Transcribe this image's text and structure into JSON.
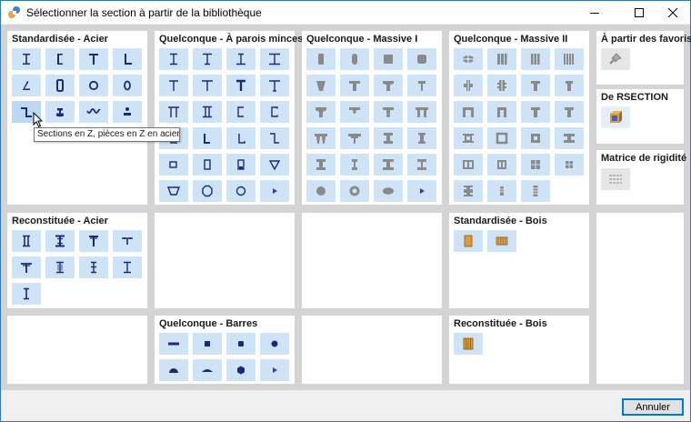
{
  "window": {
    "title": "Sélectionner la section à partir de la bibliothèque",
    "minimize_glyph": "—",
    "maximize_glyph": "☐",
    "close_glyph": "✕"
  },
  "colors": {
    "tile_bg": "#cfe3f7",
    "icon_navy": "#1b2a78",
    "icon_gray": "#8a8a8a",
    "wood_orange": "#e29a36",
    "panel_bg": "#ffffff",
    "gap_bg": "#d4d4d4"
  },
  "panels": {
    "std_acier": {
      "title": "Standardisée - Acier",
      "icons": [
        "i-section-icon",
        "channel-section-icon",
        "t-section-icon",
        "angle-section-icon",
        "unequal-angle-icon",
        "rectangular-hollow-icon",
        "circular-hollow-icon",
        "rounded-hollow-icon",
        "z-section-icon",
        "rail-section-icon",
        "corrugated-sheet-icon",
        "bulb-flat-icon"
      ]
    },
    "parois_minces": {
      "title": "Quelconque - À parois minces",
      "icons": [
        "thin-i-icon",
        "thin-i-unequal-icon",
        "thin-i-tapered-icon",
        "thin-i-wide-icon",
        "thin-t-icon",
        "thin-t-wide-icon",
        "thin-t-flanged-icon",
        "thin-t-heavy-icon",
        "thin-pi-icon",
        "thin-double-i-icon",
        "thin-channel-icon",
        "thin-channel-lipped-icon",
        "thin-angle-icon",
        "thin-angle-wide-icon",
        "thin-angle-lipped-icon",
        "thin-z-icon",
        "thin-box-icon",
        "thin-rect-icon",
        "thin-rect-closed-icon",
        "thin-triangle-icon",
        "thin-trapezoid-icon",
        "thin-octagon-icon",
        "thin-circle-icon",
        "more-arrow-icon"
      ]
    },
    "massive_1": {
      "title": "Quelconque - Massive I",
      "icons": [
        "solid-rect-icon",
        "solid-rounded-rect-icon",
        "solid-square-icon",
        "solid-rounded-square-icon",
        "solid-trapezoid-icon",
        "solid-t-icon",
        "solid-t-tapered-icon",
        "solid-t-narrow-icon",
        "solid-inverted-t-icon",
        "solid-tee-beam-icon",
        "solid-t-bulb-icon",
        "solid-double-t-icon",
        "solid-pi-icon",
        "solid-double-pi-icon",
        "solid-i-icon",
        "solid-i-heavy-icon",
        "solid-i-tapered-icon",
        "solid-i-narrow-icon",
        "solid-i-wide-icon",
        "solid-i-flanged-icon",
        "solid-circle-icon",
        "solid-ring-icon",
        "solid-ellipse-icon",
        "more-arrow-icon"
      ]
    },
    "massive_2": {
      "title": "Quelconque - Massive II",
      "icons": [
        "solid-double-ellipse-icon",
        "solid-triple-rect-icon",
        "solid-quad-rect-icon",
        "solid-multi-rect-icon",
        "solid-cross-icon",
        "solid-double-cross-icon",
        "solid-t-stem-icon",
        "solid-t-stem-short-icon",
        "solid-u-channel-icon",
        "solid-u-deep-icon",
        "solid-t-hollow-icon",
        "solid-t-double-icon",
        "solid-box-icon",
        "solid-box-frame-icon",
        "solid-box-thick-icon",
        "solid-i-box-icon",
        "solid-two-cell-icon",
        "solid-multi-cell-icon",
        "solid-four-squares-icon",
        "solid-grid-icon",
        "solid-i-stacked-icon",
        "solid-column-icon",
        "solid-column-hollow-icon"
      ]
    },
    "favoris": {
      "title": "À partir des favoris",
      "icon": "pushpin-icon"
    },
    "rsection": {
      "title": "De RSECTION",
      "icon": "rsection-icon"
    },
    "rigidite": {
      "title": "Matrice de rigidité",
      "icon": "matrix-grid-icon"
    },
    "recon_acier": {
      "title": "Reconstituée - Acier",
      "icons": [
        "double-i-built-up-icon",
        "i-plated-built-up-icon",
        "t-plated-built-up-icon",
        "t-angle-built-up-icon",
        "t-wide-built-up-icon",
        "i-double-plate-icon",
        "i-stiffened-icon",
        "i-flange-plate-icon",
        "i-cover-plate-icon"
      ]
    },
    "std_bois": {
      "title": "Standardisée - Bois",
      "icons": [
        "timber-rect-icon",
        "timber-glulam-icon"
      ]
    },
    "barres": {
      "title": "Quelconque - Barres",
      "icons": [
        "bar-flat-icon",
        "bar-square-icon",
        "bar-square-rounded-icon",
        "bar-round-icon",
        "bar-half-round-icon",
        "bar-segment-icon",
        "bar-hexagon-icon",
        "more-arrow-icon"
      ]
    },
    "recon_bois": {
      "title": "Reconstituée - Bois",
      "icons": [
        "timber-layered-icon"
      ]
    }
  },
  "tooltip": {
    "text": "Sections en Z, pièces en Z en acier..."
  },
  "footer": {
    "cancel_label": "Annuler"
  }
}
